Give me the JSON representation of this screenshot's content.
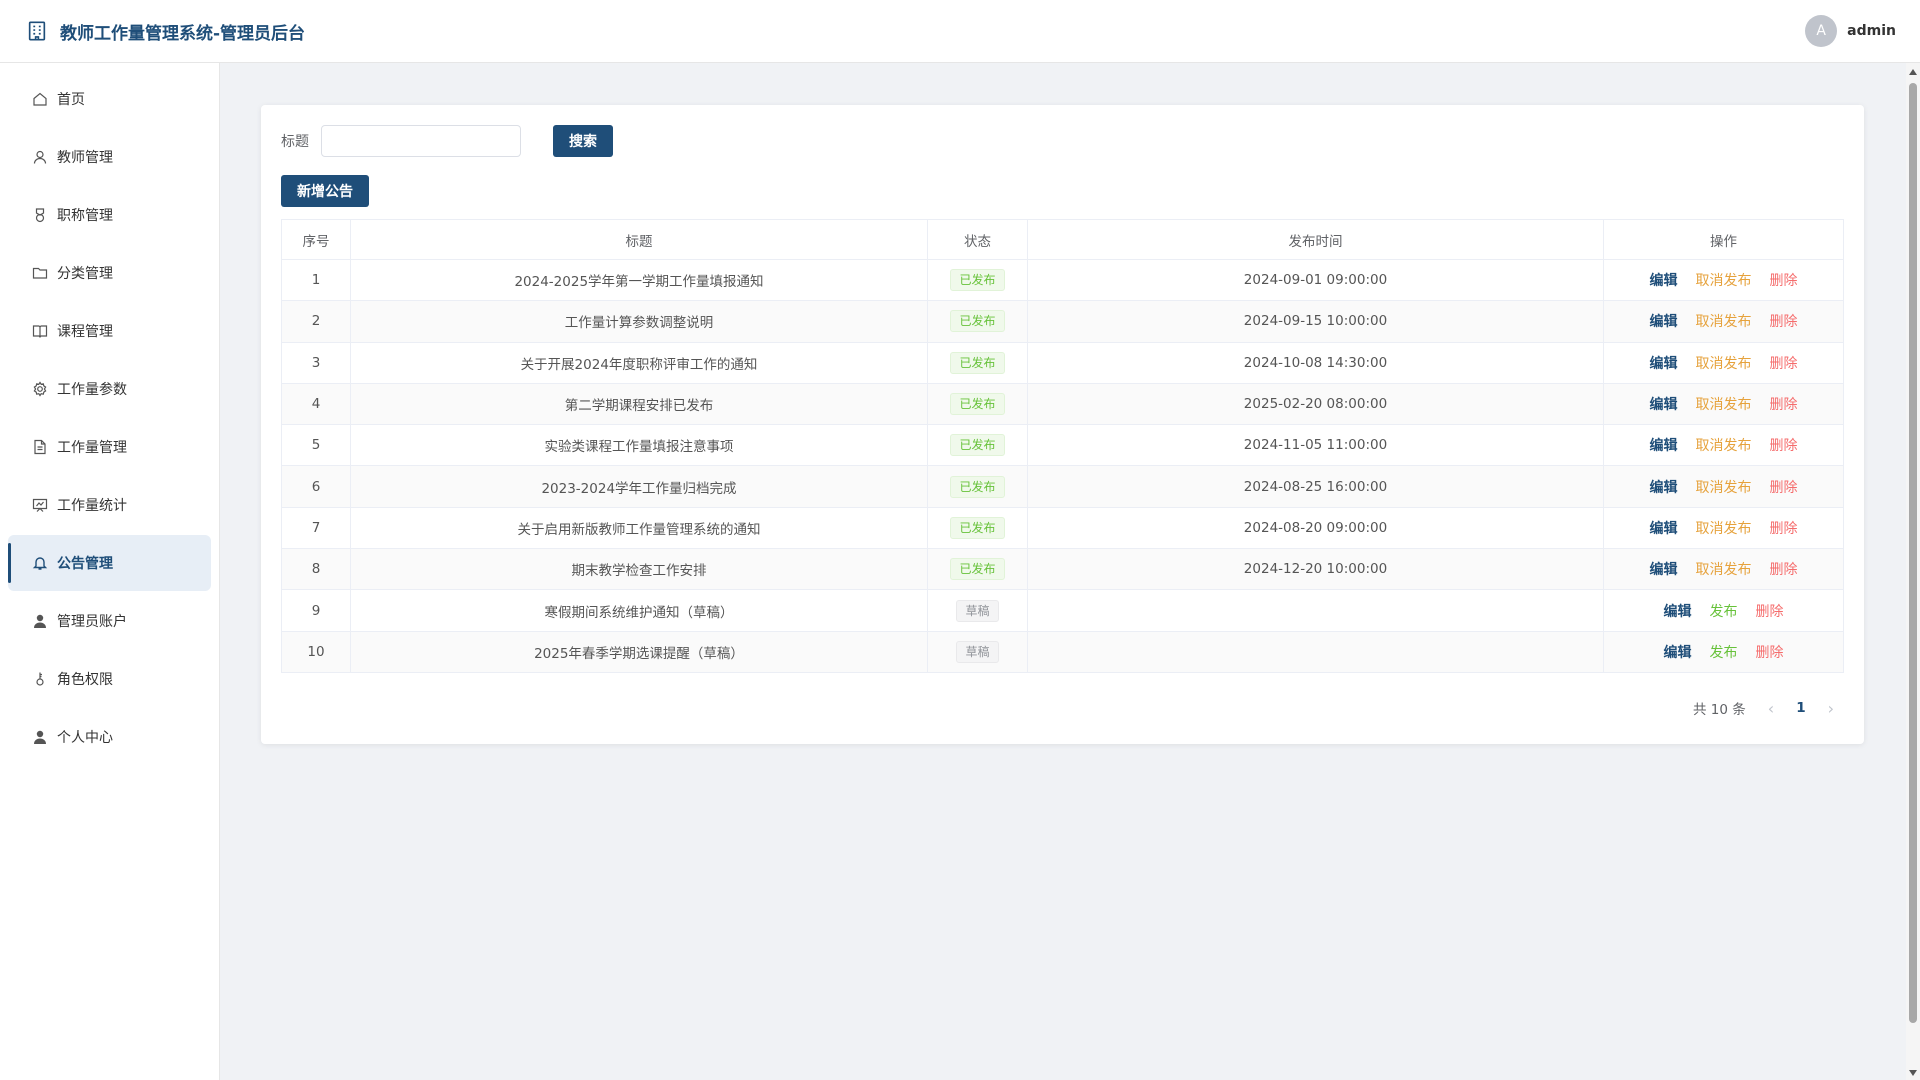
{
  "header": {
    "title": "教师工作量管理系统-管理员后台",
    "avatar_initial": "A",
    "username": "admin"
  },
  "sidebar": {
    "items": [
      {
        "label": "首页",
        "icon": "home-icon"
      },
      {
        "label": "教师管理",
        "icon": "user-icon"
      },
      {
        "label": "职称管理",
        "icon": "medal-icon"
      },
      {
        "label": "分类管理",
        "icon": "folder-icon"
      },
      {
        "label": "课程管理",
        "icon": "book-icon"
      },
      {
        "label": "工作量参数",
        "icon": "gear-icon"
      },
      {
        "label": "工作量管理",
        "icon": "document-icon"
      },
      {
        "label": "工作量统计",
        "icon": "chart-board-icon"
      },
      {
        "label": "公告管理",
        "icon": "bell-icon",
        "active": true
      },
      {
        "label": "管理员账户",
        "icon": "user-solid-icon"
      },
      {
        "label": "角色权限",
        "icon": "key-icon"
      },
      {
        "label": "个人中心",
        "icon": "user-solid-icon"
      }
    ]
  },
  "search": {
    "label": "标题",
    "value": "",
    "placeholder": "",
    "button": "搜索"
  },
  "toolbar": {
    "add_label": "新增公告"
  },
  "table": {
    "headers": [
      "序号",
      "标题",
      "状态",
      "发布时间",
      "操作"
    ],
    "rows": [
      {
        "index": "1",
        "title": "2024-2025学年第一学期工作量填报通知",
        "status": "已发布",
        "published": true,
        "time": "2024-09-01 09:00:00"
      },
      {
        "index": "2",
        "title": "工作量计算参数调整说明",
        "status": "已发布",
        "published": true,
        "time": "2024-09-15 10:00:00"
      },
      {
        "index": "3",
        "title": "关于开展2024年度职称评审工作的通知",
        "status": "已发布",
        "published": true,
        "time": "2024-10-08 14:30:00"
      },
      {
        "index": "4",
        "title": "第二学期课程安排已发布",
        "status": "已发布",
        "published": true,
        "time": "2025-02-20 08:00:00"
      },
      {
        "index": "5",
        "title": "实验类课程工作量填报注意事项",
        "status": "已发布",
        "published": true,
        "time": "2024-11-05 11:00:00"
      },
      {
        "index": "6",
        "title": "2023-2024学年工作量归档完成",
        "status": "已发布",
        "published": true,
        "time": "2024-08-25 16:00:00"
      },
      {
        "index": "7",
        "title": "关于启用新版教师工作量管理系统的通知",
        "status": "已发布",
        "published": true,
        "time": "2024-08-20 09:00:00"
      },
      {
        "index": "8",
        "title": "期末教学检查工作安排",
        "status": "已发布",
        "published": true,
        "time": "2024-12-20 10:00:00"
      },
      {
        "index": "9",
        "title": "寒假期间系统维护通知（草稿）",
        "status": "草稿",
        "published": false,
        "time": ""
      },
      {
        "index": "10",
        "title": "2025年春季学期选课提醒（草稿）",
        "status": "草稿",
        "published": false,
        "time": ""
      }
    ],
    "actions": {
      "edit": "编辑",
      "unpublish": "取消发布",
      "publish": "发布",
      "delete": "删除"
    }
  },
  "pagination": {
    "total": "共 10 条",
    "prev": "‹",
    "current": "1",
    "next": "›"
  },
  "colors": {
    "primary": "#1f4e79",
    "published": "#67c23a",
    "unpublish": "#e6a23c",
    "delete": "#f56c6c",
    "draft": "#909399"
  }
}
